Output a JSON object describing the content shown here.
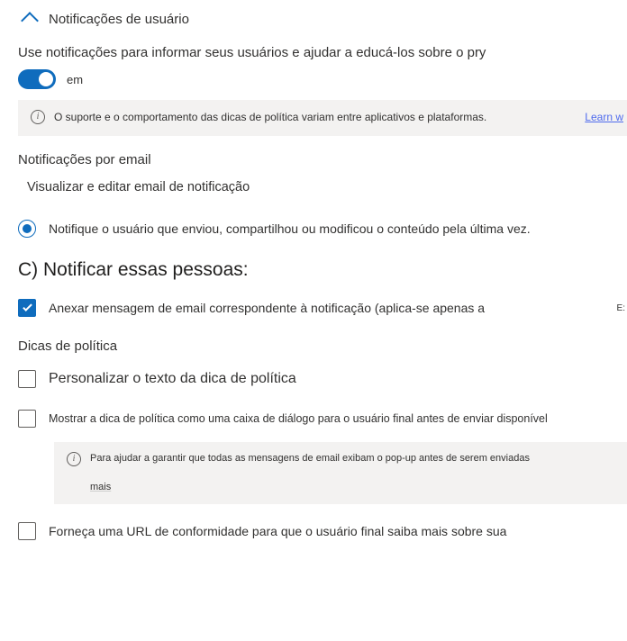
{
  "section": {
    "title": "Notificações de usuário"
  },
  "intro": "Use notificações para informar seus usuários e ajudar a educá-los sobre o pry",
  "toggle": {
    "state": "on",
    "label": "em"
  },
  "info1": {
    "text": "O suporte e o comportamento das dicas de política variam entre aplicativos e plataformas.",
    "link": "Learn w"
  },
  "email": {
    "heading": "Notificações por email",
    "view_edit": "Visualizar e editar email de notificação"
  },
  "radio1": {
    "label": "Notifique o usuário que enviou, compartilhou ou modificou o conteúdo pela última vez."
  },
  "notify_heading": "C) Notificar essas pessoas:",
  "attach": {
    "label": "Anexar mensagem de email correspondente à notificação (aplica-se apenas a",
    "side": "E:"
  },
  "tips": {
    "heading": "Dicas de política",
    "custom_text": "Personalizar o texto da dica de política",
    "show_dialog": "Mostrar a dica de política como uma caixa de diálogo para o usuário final antes de enviar disponível",
    "info2": {
      "text": "Para ajudar a garantir que todas as mensagens de email exibam o pop-up antes de serem enviadas",
      "more": "mais"
    },
    "provide_url": "Forneça uma URL de conformidade para que o usuário final saiba mais sobre sua"
  }
}
